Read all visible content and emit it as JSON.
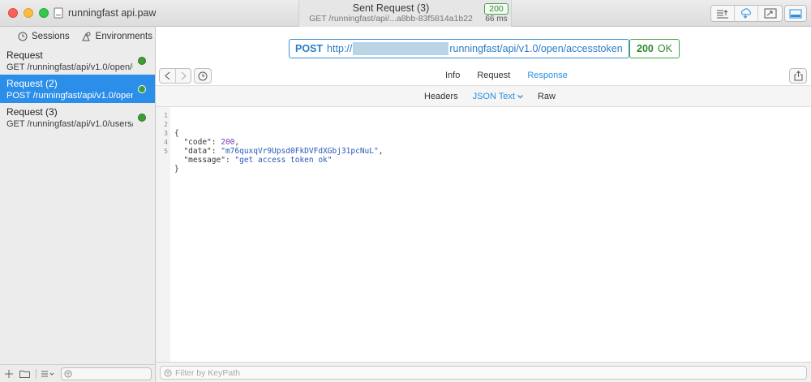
{
  "window": {
    "title": "runningfast api.paw",
    "sent_title": "Sent Request (3)",
    "sent_url": "GET /runningfast/api/...a8bb-83f5814a1b22",
    "sent_status": "200",
    "sent_time": "66 ms"
  },
  "sidebar": {
    "tabs": [
      {
        "label": "Sessions",
        "icon": "clock-icon"
      },
      {
        "label": "Environments",
        "icon": "environments-icon"
      }
    ],
    "items": [
      {
        "name": "Request",
        "sub": "GET /runningfast/api/v1.0/open/u..."
      },
      {
        "name": "Request (2)",
        "sub": "POST /runningfast/api/v1.0/open/..."
      },
      {
        "name": "Request (3)",
        "sub": "GET /runningfast/api/v1.0/users/u..."
      }
    ]
  },
  "request": {
    "method": "POST",
    "url_prefix": "http://",
    "url_suffix": "runningfast/api/v1.0/open/accesstoken",
    "status_code": "200",
    "status_text": "OK"
  },
  "tabs": [
    "Info",
    "Request",
    "Response"
  ],
  "active_tab": "Response",
  "subtabs": [
    "Headers",
    "JSON Text",
    "Raw"
  ],
  "active_subtab": "JSON Text",
  "response": {
    "lines": [
      {
        "num": "1",
        "open": "{"
      },
      {
        "num": "2",
        "key": "\"code\"",
        "value": "200",
        "tail": ","
      },
      {
        "num": "3",
        "key": "\"data\"",
        "value": "\"m76quxqVr9Upsd0FkDVFdXGbj31pcNuL\"",
        "tail": ","
      },
      {
        "num": "4",
        "key": "\"message\"",
        "value": "\"get access token ok\"",
        "tail": ""
      },
      {
        "num": "5",
        "close": "}"
      }
    ]
  },
  "filter": {
    "placeholder": "Filter by KeyPath"
  },
  "colors": {
    "accent": "#2b8ee9",
    "success": "#3f9b36"
  }
}
